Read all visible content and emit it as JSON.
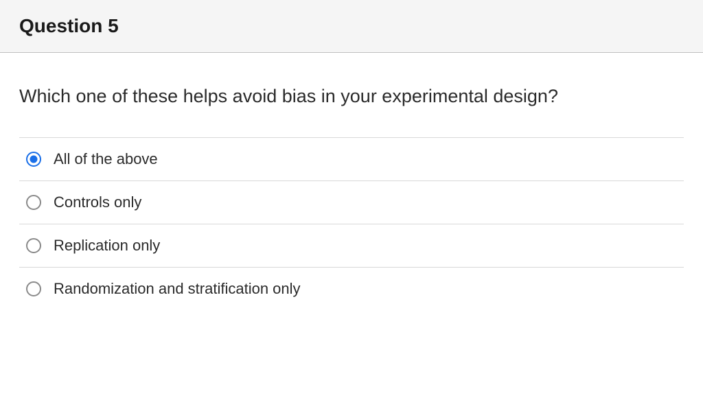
{
  "header": {
    "title": "Question 5"
  },
  "question": {
    "text": "Which one of these helps avoid bias in your experimental design?"
  },
  "options": [
    {
      "label": "All of the above",
      "selected": true
    },
    {
      "label": "Controls only",
      "selected": false
    },
    {
      "label": "Replication only",
      "selected": false
    },
    {
      "label": "Randomization and stratification only",
      "selected": false
    }
  ]
}
